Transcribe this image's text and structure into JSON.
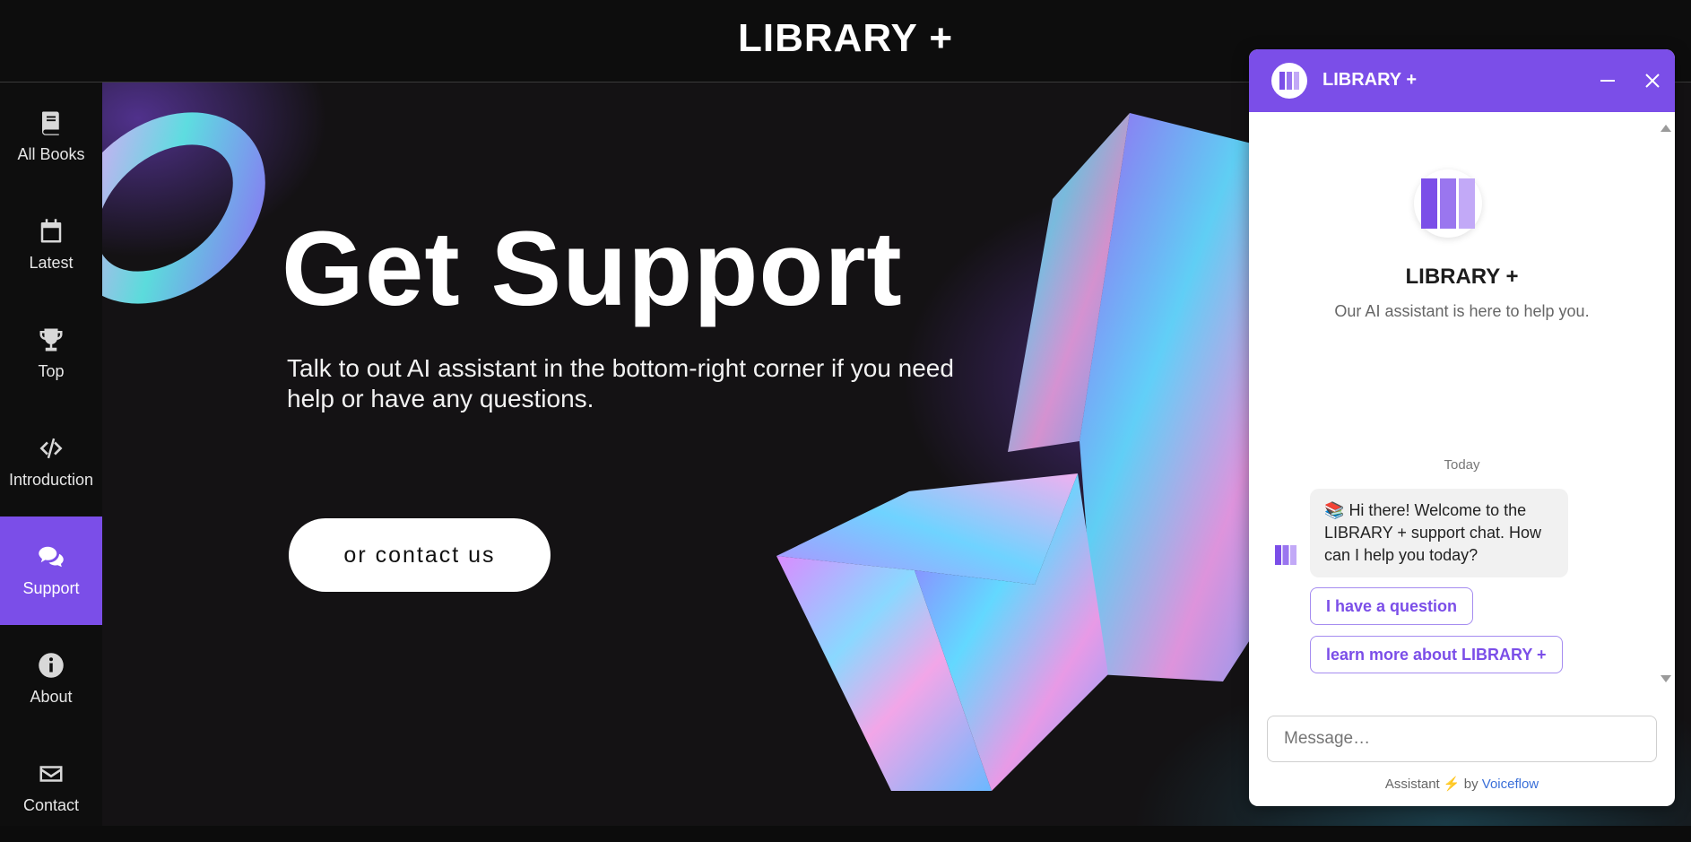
{
  "header": {
    "title": "LIBRARY +"
  },
  "sidebar": {
    "items": [
      {
        "label": "All Books",
        "icon": "book-icon"
      },
      {
        "label": "Latest",
        "icon": "calendar-icon"
      },
      {
        "label": "Top",
        "icon": "trophy-icon"
      },
      {
        "label": "Introduction",
        "icon": "code-icon"
      },
      {
        "label": "Support",
        "icon": "chat-icon",
        "active": true
      },
      {
        "label": "About",
        "icon": "info-icon"
      },
      {
        "label": "Contact",
        "icon": "envelope-icon"
      }
    ],
    "active_color": "#7b4ee8"
  },
  "hero": {
    "heading": "Get Support",
    "text": "Talk to out AI assistant in the bottom-right corner if you need help or have any questions.",
    "button_label": "or contact us"
  },
  "chat": {
    "header_title": "LIBRARY +",
    "assistant_name": "LIBRARY +",
    "assistant_desc": "Our AI assistant is here to help you.",
    "day_label": "Today",
    "bot_message": "Hi there! Welcome to the LIBRARY + support chat. How can I help you today?",
    "message_emoji": "📚",
    "choices": [
      "I have a question",
      "learn more about LIBRARY +"
    ],
    "input_placeholder": "Message…",
    "footer_prefix": "Assistant",
    "footer_by": "by",
    "footer_link": "Voiceflow",
    "accent": "#7b4ee8"
  }
}
